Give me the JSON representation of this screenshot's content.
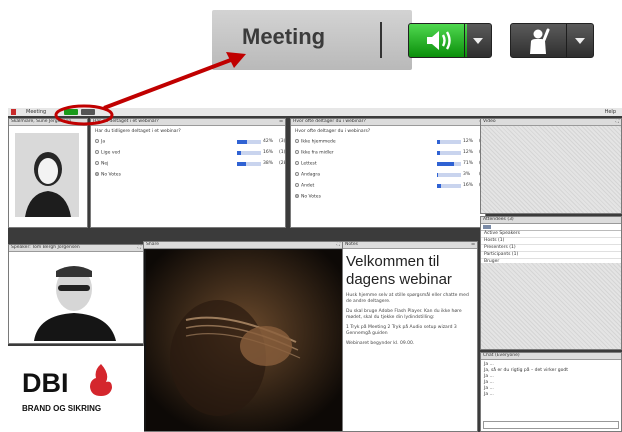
{
  "toolbar_zoom": {
    "meeting_label": "Meeting",
    "audio_icon": "speaker-icon",
    "raise_hand_icon": "raise-hand-icon",
    "audio_color": "#19b319",
    "callout_color": "#c00000"
  },
  "menubar": {
    "menu_label": "Meeting",
    "help_label": "Help"
  },
  "camera_pod_1": {
    "title": "Skalmiare, Sune Jergensen"
  },
  "camera_pod_2": {
    "title": "Speaker: Tom Bergh Jorgensen"
  },
  "poll1": {
    "title": "Har du deltaget i et webinar?",
    "question": "Har du tidligere deltaget i et webinar?",
    "options": [
      {
        "label": "Ja",
        "pct": "42%",
        "count": "(3)",
        "value": 0.42,
        "selected": false
      },
      {
        "label": "Lige ved",
        "pct": "16%",
        "count": "(1)",
        "value": 0.16,
        "selected": false
      },
      {
        "label": "Nej",
        "pct": "38%",
        "count": "(28)",
        "value": 0.38,
        "selected": false
      },
      {
        "label": "No Votes",
        "pct": "",
        "count": "",
        "value": 0,
        "selected": true
      }
    ]
  },
  "poll2": {
    "title": "Hvor ofte deltager du i webinar?",
    "question": "Hvor ofte deltager du i webinars?",
    "options": [
      {
        "label": "Ikke hjemmede",
        "pct": "12%",
        "count": "(3)",
        "value": 0.12,
        "selected": false
      },
      {
        "label": "Ikke fra midler",
        "pct": "12%",
        "count": "(3)",
        "value": 0.12,
        "selected": false
      },
      {
        "label": "Lettest",
        "pct": "71%",
        "count": "(18)",
        "value": 0.71,
        "selected": false
      },
      {
        "label": "Andagra",
        "pct": "3%",
        "count": "(1)",
        "value": 0.03,
        "selected": false
      },
      {
        "label": "Andet",
        "pct": "16%",
        "count": "(5)",
        "value": 0.16,
        "selected": false
      },
      {
        "label": "No Votes",
        "pct": "",
        "count": "",
        "value": 0,
        "selected": true
      }
    ]
  },
  "video_pod": {
    "title": "Video"
  },
  "attendees_pod": {
    "title": "Attendees (3)",
    "items": [
      "Active Speakers",
      "Hosts (1)",
      "Presenters (1)",
      "Participants (1)",
      "Bruger"
    ]
  },
  "share_pod": {
    "title": "Share"
  },
  "notes_pod": {
    "title": "Notes",
    "heading": "Velkommen til dagens webinar",
    "paragraphs": [
      "Husk hjemme selv at stille spørgsmål eller chatte med de andre deltagere.",
      "Du skal bruge Adobe Flash Player. Kan du ikke høre mødet, skal du tjekke din lydindstilling:",
      "1 Tryk på Meeting 2 Tryk på Audio setup wizard 3 Gennemgå guiden",
      "Webinaret begynder kl. 09.00."
    ]
  },
  "chat_pod": {
    "title": "Chat (Everyone)",
    "messages": [
      "Ja ...",
      "Ja, så er du rigtig på – det virker godt",
      "Ja ...",
      "Ja ...",
      "Ja ...",
      "Ja ..."
    ]
  },
  "logo": {
    "brand": "DBI",
    "tagline": "BRAND OG SIKRING",
    "brand_color": "#d4262d"
  }
}
